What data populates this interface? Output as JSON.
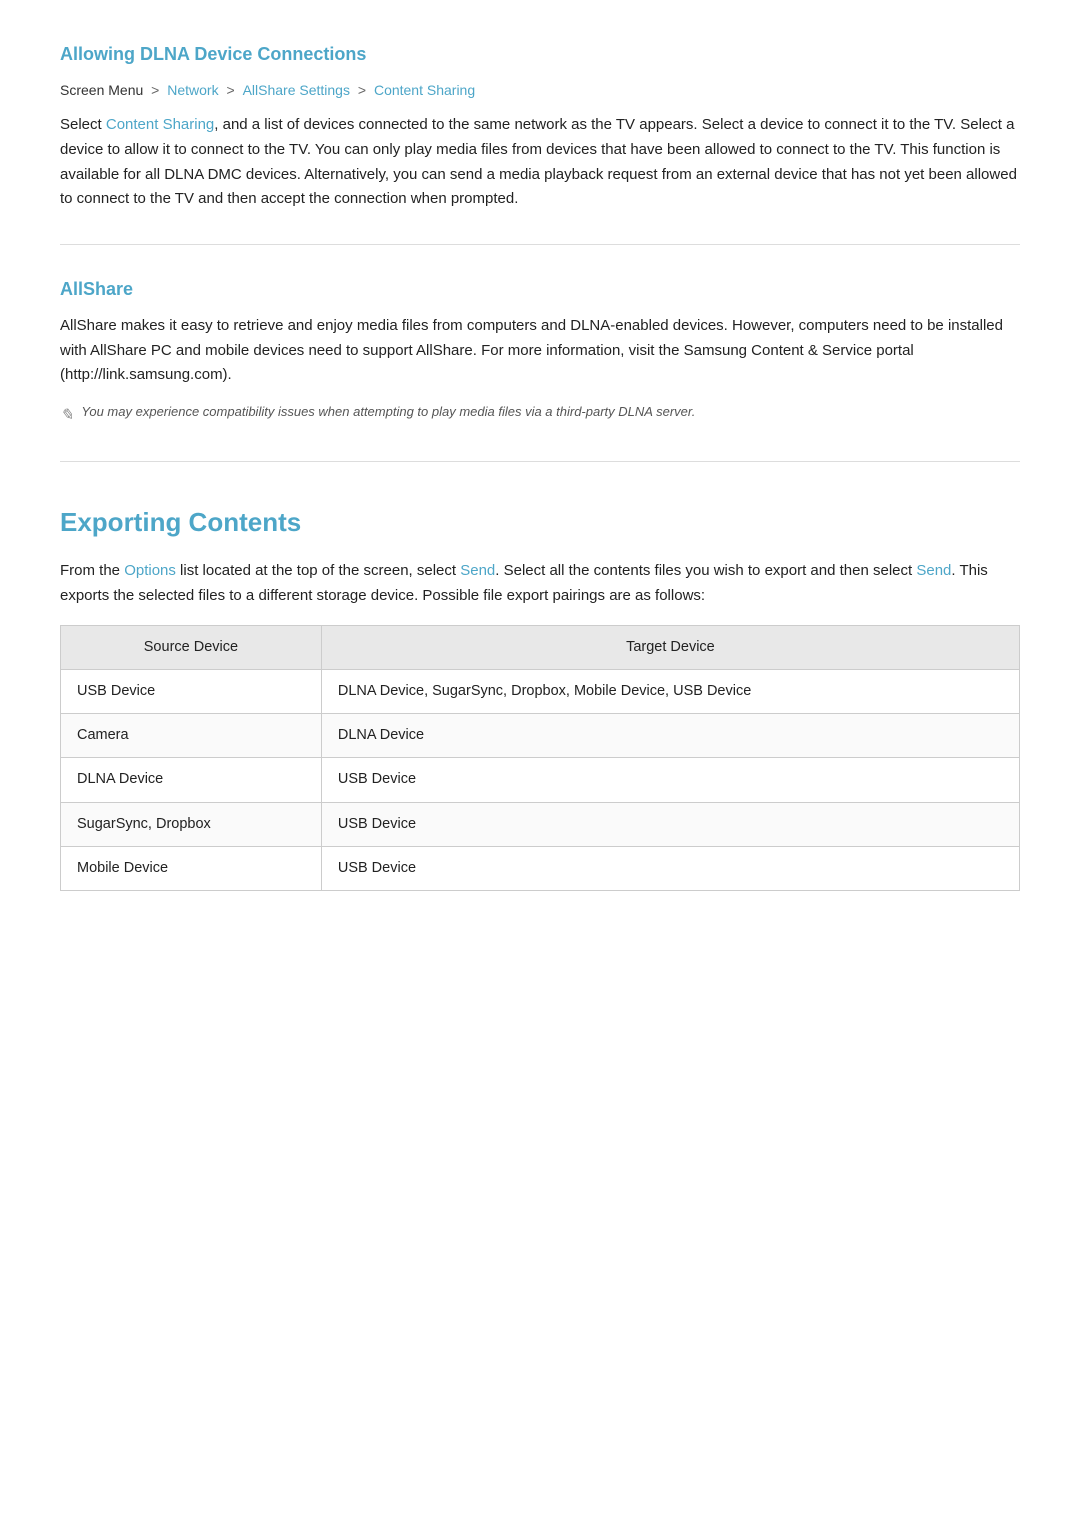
{
  "page": {
    "section1": {
      "title": "Allowing DLNA Device Connections",
      "breadcrumb": {
        "prefix": "Screen Menu",
        "items": [
          {
            "label": "Network",
            "link": true
          },
          {
            "label": "AllShare Settings",
            "link": true
          },
          {
            "label": "Content Sharing",
            "link": true
          }
        ]
      },
      "body": "Select Content Sharing, and a list of devices connected to the same network as the TV appears. Select a device to connect it to the TV. Select a device to allow it to connect to the TV. You can only play media files from devices that have been allowed to connect to the TV. This function is available for all DLNA DMC devices. Alternatively, you can send a media playback request from an external device that has not yet been allowed to connect to the TV and then accept the connection when prompted."
    },
    "section2": {
      "title": "AllShare",
      "body": "AllShare makes it easy to retrieve and enjoy media files from computers and DLNA-enabled devices. However, computers need to be installed with AllShare PC and mobile devices need to support AllShare. For more information, visit the Samsung Content & Service portal (http://link.samsung.com).",
      "note": "You may experience compatibility issues when attempting to play media files via a third-party DLNA server."
    },
    "section3": {
      "title": "Exporting Contents",
      "body_prefix": "From the ",
      "options_link": "Options",
      "body_middle": " list located at the top of the screen, select ",
      "send_link1": "Send",
      "body_middle2": ". Select all the contents files you wish to export and then select ",
      "send_link2": "Send",
      "body_suffix": ". This exports the selected files to a different storage device. Possible file export pairings are as follows:",
      "table": {
        "headers": [
          "Source Device",
          "Target Device"
        ],
        "rows": [
          {
            "source": "USB Device",
            "target": "DLNA Device, SugarSync, Dropbox, Mobile Device, USB Device"
          },
          {
            "source": "Camera",
            "target": "DLNA Device"
          },
          {
            "source": "DLNA Device",
            "target": "USB Device"
          },
          {
            "source": "SugarSync, Dropbox",
            "target": "USB Device"
          },
          {
            "source": "Mobile Device",
            "target": "USB Device"
          }
        ]
      }
    }
  }
}
